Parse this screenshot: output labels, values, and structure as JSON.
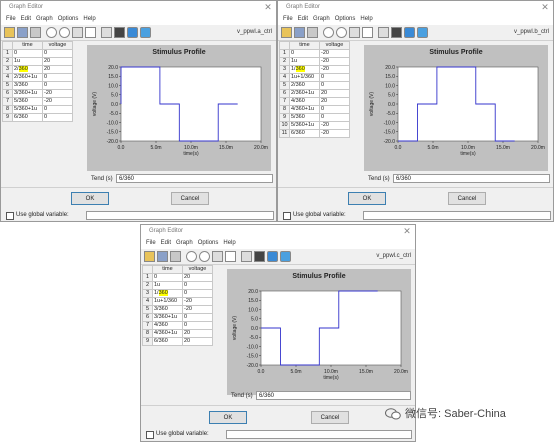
{
  "menu": [
    "File",
    "Edit",
    "Graph",
    "Options",
    "Help"
  ],
  "ok_label": "OK",
  "cancel_label": "Cancel",
  "tend_label": "Tend (s)",
  "global_var_label": "Use global variable:",
  "col_time": "time",
  "col_voltage": "voltage",
  "plot_title": "Stimulus Profile",
  "y_axis_label": "voltage (V)",
  "x_axis_label": "time(s)",
  "y_ticks": [
    "20.0",
    "15.0",
    "10.0",
    "5.0",
    "0.0",
    "-5.0",
    "-10.0",
    "-15.0",
    "-20.0"
  ],
  "x_ticks": [
    "0.0",
    "5.0m",
    "10.0m",
    "15.0m",
    "20.0m"
  ],
  "windows": [
    {
      "title": "Graph Editor",
      "name": "v_ppwl.a_ctrl",
      "tend": "6/360",
      "rows": [
        {
          "n": "1",
          "t": "0",
          "v": "0"
        },
        {
          "n": "2",
          "t": "1u",
          "v": "20"
        },
        {
          "n": "3",
          "t": "2/360",
          "v": "20",
          "hl": "360"
        },
        {
          "n": "4",
          "t": "2/360+1u",
          "v": "0"
        },
        {
          "n": "5",
          "t": "3/360",
          "v": "0"
        },
        {
          "n": "6",
          "t": "3/360+1u",
          "v": "-20"
        },
        {
          "n": "7",
          "t": "5/360",
          "v": "-20"
        },
        {
          "n": "8",
          "t": "5/360+1u",
          "v": "0"
        },
        {
          "n": "9",
          "t": "6/360",
          "v": "0"
        }
      ],
      "chart_data": {
        "type": "line",
        "title": "Stimulus Profile",
        "xlabel": "time(s)",
        "ylabel": "voltage (V)",
        "xlim": [
          0,
          0.02
        ],
        "ylim": [
          -20,
          20
        ],
        "x": [
          0,
          1e-06,
          0.005556,
          0.005557,
          0.008333,
          0.008334,
          0.013889,
          0.01389,
          0.016667
        ],
        "y": [
          0,
          20,
          20,
          0,
          0,
          -20,
          -20,
          0,
          0
        ]
      }
    },
    {
      "title": "Graph Editor",
      "name": "v_ppwl.b_ctrl",
      "tend": "6/360",
      "rows": [
        {
          "n": "1",
          "t": "0",
          "v": "-20"
        },
        {
          "n": "2",
          "t": "1u",
          "v": "-20"
        },
        {
          "n": "3",
          "t": "1/360",
          "v": "-20",
          "hl": "360"
        },
        {
          "n": "4",
          "t": "1u+1/360",
          "v": "0"
        },
        {
          "n": "5",
          "t": "2/360",
          "v": "0"
        },
        {
          "n": "6",
          "t": "2/360+1u",
          "v": "20"
        },
        {
          "n": "7",
          "t": "4/360",
          "v": "20"
        },
        {
          "n": "8",
          "t": "4/360+1u",
          "v": "0"
        },
        {
          "n": "9",
          "t": "5/360",
          "v": "0"
        },
        {
          "n": "10",
          "t": "5/360+1u",
          "v": "-20"
        },
        {
          "n": "11",
          "t": "6/360",
          "v": "-20"
        }
      ],
      "chart_data": {
        "type": "line",
        "title": "Stimulus Profile",
        "xlabel": "time(s)",
        "ylabel": "voltage (V)",
        "xlim": [
          0,
          0.02
        ],
        "ylim": [
          -20,
          20
        ],
        "x": [
          0,
          1e-06,
          0.002778,
          0.002779,
          0.005556,
          0.005557,
          0.011111,
          0.011112,
          0.013889,
          0.01389,
          0.016667
        ],
        "y": [
          -20,
          -20,
          -20,
          0,
          0,
          20,
          20,
          0,
          0,
          -20,
          -20
        ]
      }
    },
    {
      "title": "Graph Editor",
      "name": "v_ppwl.c_ctrl",
      "tend": "6/360",
      "rows": [
        {
          "n": "1",
          "t": "0",
          "v": "20"
        },
        {
          "n": "2",
          "t": "1u",
          "v": "0"
        },
        {
          "n": "3",
          "t": "1/360",
          "v": "0",
          "hl": "360"
        },
        {
          "n": "4",
          "t": "1u+1/360",
          "v": "-20"
        },
        {
          "n": "5",
          "t": "3/360",
          "v": "-20"
        },
        {
          "n": "6",
          "t": "3/360+1u",
          "v": "0"
        },
        {
          "n": "7",
          "t": "4/360",
          "v": "0"
        },
        {
          "n": "8",
          "t": "4/360+1u",
          "v": "20"
        },
        {
          "n": "9",
          "t": "6/360",
          "v": "20"
        }
      ],
      "chart_data": {
        "type": "line",
        "title": "Stimulus Profile",
        "xlabel": "time(s)",
        "ylabel": "voltage (V)",
        "xlim": [
          0,
          0.02
        ],
        "ylim": [
          -20,
          20
        ],
        "x": [
          0,
          1e-06,
          0.002778,
          0.002779,
          0.008333,
          0.008334,
          0.011111,
          0.011112,
          0.016667
        ],
        "y": [
          0,
          0,
          0,
          -20,
          -20,
          0,
          0,
          20,
          20
        ]
      }
    }
  ],
  "watermark": "微信号: Saber-China",
  "colors": {
    "series": "#3333cc",
    "plot_bg": "#c0c0c0",
    "highlight": "#ffff00"
  }
}
